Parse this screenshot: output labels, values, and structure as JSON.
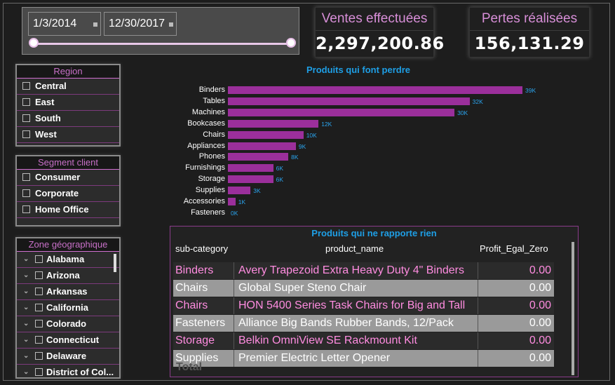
{
  "date_range": {
    "start": "1/3/2014",
    "end": "12/30/2017"
  },
  "kpi": {
    "sales_title": "Ventes effectuées",
    "sales_value": "2,297,200.86",
    "loss_title": "Pertes réalisées",
    "loss_value": "156,131.29"
  },
  "region": {
    "title": "Region",
    "items": [
      "Central",
      "East",
      "South",
      "West"
    ]
  },
  "segment": {
    "title": "Segment client",
    "items": [
      "Consumer",
      "Corporate",
      "Home Office"
    ]
  },
  "zone": {
    "title": "Zone géographique",
    "items": [
      "Alabama",
      "Arizona",
      "Arkansas",
      "California",
      "Colorado",
      "Connecticut",
      "Delaware",
      "District of Col..."
    ]
  },
  "chart_data": {
    "type": "bar",
    "title": "Produits qui font perdre",
    "categories": [
      "Binders",
      "Tables",
      "Machines",
      "Bookcases",
      "Chairs",
      "Appliances",
      "Phones",
      "Furnishings",
      "Storage",
      "Supplies",
      "Accessories",
      "Fasteners"
    ],
    "values": [
      39000,
      32000,
      30000,
      12000,
      10000,
      9000,
      8000,
      6000,
      6000,
      3000,
      1000,
      0
    ],
    "data_labels": [
      "39K",
      "32K",
      "30K",
      "12K",
      "10K",
      "9K",
      "8K",
      "6K",
      "6K",
      "3K",
      "1K",
      "0K"
    ],
    "orientation": "horizontal",
    "color": "#9b2f9b"
  },
  "table": {
    "title": "Produits qui ne rapporte rien",
    "headers": [
      "sub-category",
      "product_name",
      "Profit_Egal_Zero"
    ],
    "rows": [
      [
        "Binders",
        "Avery Trapezoid Extra Heavy Duty 4\" Binders",
        "0.00"
      ],
      [
        "Chairs",
        "Global Super Steno Chair",
        "0.00"
      ],
      [
        "Chairs",
        "HON 5400 Series Task Chairs for Big and Tall",
        "0.00"
      ],
      [
        "Fasteners",
        "Alliance Big Bands Rubber Bands, 12/Pack",
        "0.00"
      ],
      [
        "Storage",
        "Belkin OmniView SE Rackmount Kit",
        "0.00"
      ],
      [
        "Supplies",
        "Premier Electric Letter Opener",
        "0.00"
      ]
    ],
    "total_label": "Total"
  }
}
